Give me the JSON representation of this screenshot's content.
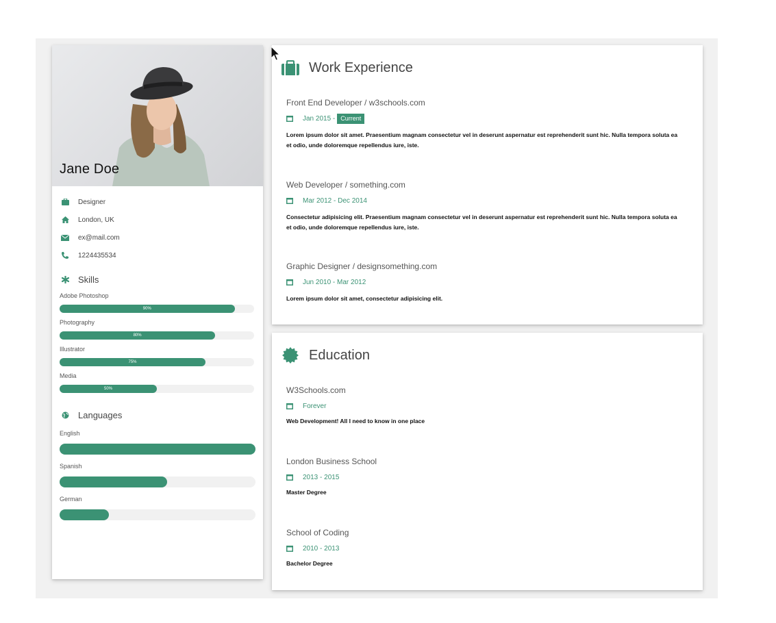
{
  "profile": {
    "name": "Jane Doe",
    "job": "Designer",
    "location": "London, UK",
    "email": "ex@mail.com",
    "phone": "1224435534"
  },
  "skills": {
    "heading": "Skills",
    "items": [
      {
        "label": "Adobe Photoshop",
        "percent": 90,
        "text": "90%"
      },
      {
        "label": "Photography",
        "percent": 80,
        "text": "80%"
      },
      {
        "label": "Illustrator",
        "percent": 75,
        "text": "75%"
      },
      {
        "label": "Media",
        "percent": 50,
        "text": "50%"
      }
    ]
  },
  "languages": {
    "heading": "Languages",
    "items": [
      {
        "label": "English",
        "percent": 100
      },
      {
        "label": "Spanish",
        "percent": 55
      },
      {
        "label": "German",
        "percent": 25
      }
    ]
  },
  "work": {
    "title": "Work Experience",
    "entries": [
      {
        "title": "Front End Developer / w3schools.com",
        "date": "Jan 2015 -",
        "badge": "Current",
        "desc": "Lorem ipsum dolor sit amet. Praesentium magnam consectetur vel in deserunt aspernatur est reprehenderit sunt hic. Nulla tempora soluta ea et odio, unde doloremque repellendus iure, iste."
      },
      {
        "title": "Web Developer / something.com",
        "date": "Mar 2012 - Dec 2014",
        "desc": "Consectetur adipisicing elit. Praesentium magnam consectetur vel in deserunt aspernatur est reprehenderit sunt hic. Nulla tempora soluta ea et odio, unde doloremque repellendus iure, iste."
      },
      {
        "title": "Graphic Designer / designsomething.com",
        "date": "Jun 2010 - Mar 2012",
        "desc": "Lorem ipsum dolor sit amet, consectetur adipisicing elit."
      }
    ]
  },
  "education": {
    "title": "Education",
    "entries": [
      {
        "title": "W3Schools.com",
        "date": "Forever",
        "desc": "Web Development! All I need to know in one place"
      },
      {
        "title": "London Business School",
        "date": "2013 - 2015",
        "desc": "Master Degree"
      },
      {
        "title": "School of Coding",
        "date": "2010 - 2013",
        "desc": "Bachelor Degree"
      }
    ]
  },
  "colors": {
    "accent": "#3b9274",
    "track": "#f1f1f1"
  },
  "icons": [
    "briefcase-icon",
    "home-icon",
    "envelope-icon",
    "phone-icon",
    "asterisk-icon",
    "globe-icon",
    "calendar-icon",
    "certificate-icon",
    "mouse-cursor-icon"
  ]
}
